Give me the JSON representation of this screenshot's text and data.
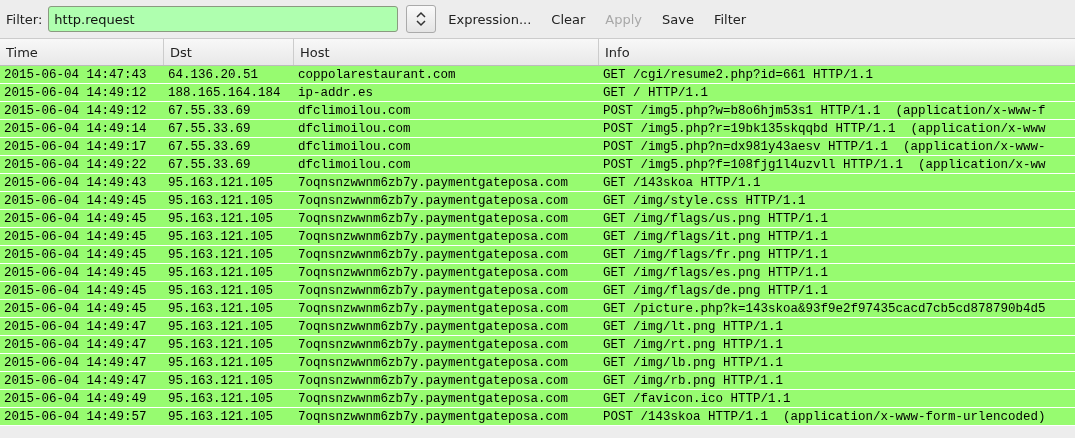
{
  "filter_bar": {
    "label": "Filter:",
    "value": "http.request",
    "valid": true,
    "buttons": [
      {
        "label": "Expression...",
        "disabled": false
      },
      {
        "label": "Clear",
        "disabled": false
      },
      {
        "label": "Apply",
        "disabled": true
      },
      {
        "label": "Save",
        "disabled": false
      },
      {
        "label": "Filter",
        "disabled": false
      }
    ]
  },
  "table": {
    "columns": [
      "Time",
      "Dst",
      "Host",
      "Info"
    ],
    "rows": [
      [
        "2015-06-04 14:47:43",
        "64.136.20.51",
        "coppolarestaurant.com",
        "GET /cgi/resume2.php?id=661 HTTP/1.1"
      ],
      [
        "2015-06-04 14:49:12",
        "188.165.164.184",
        "ip-addr.es",
        "GET / HTTP/1.1"
      ],
      [
        "2015-06-04 14:49:12",
        "67.55.33.69",
        "dfclimoilou.com",
        "POST /img5.php?w=b8o6hjm53s1 HTTP/1.1  (application/x-www-f"
      ],
      [
        "2015-06-04 14:49:14",
        "67.55.33.69",
        "dfclimoilou.com",
        "POST /img5.php?r=19bk135skqqbd HTTP/1.1  (application/x-www"
      ],
      [
        "2015-06-04 14:49:17",
        "67.55.33.69",
        "dfclimoilou.com",
        "POST /img5.php?n=dx981y43aesv HTTP/1.1  (application/x-www-"
      ],
      [
        "2015-06-04 14:49:22",
        "67.55.33.69",
        "dfclimoilou.com",
        "POST /img5.php?f=108fjg1l4uzvll HTTP/1.1  (application/x-ww"
      ],
      [
        "2015-06-04 14:49:43",
        "95.163.121.105",
        "7oqnsnzwwnm6zb7y.paymentgateposa.com",
        "GET /143skoa HTTP/1.1"
      ],
      [
        "2015-06-04 14:49:45",
        "95.163.121.105",
        "7oqnsnzwwnm6zb7y.paymentgateposa.com",
        "GET /img/style.css HTTP/1.1"
      ],
      [
        "2015-06-04 14:49:45",
        "95.163.121.105",
        "7oqnsnzwwnm6zb7y.paymentgateposa.com",
        "GET /img/flags/us.png HTTP/1.1"
      ],
      [
        "2015-06-04 14:49:45",
        "95.163.121.105",
        "7oqnsnzwwnm6zb7y.paymentgateposa.com",
        "GET /img/flags/it.png HTTP/1.1"
      ],
      [
        "2015-06-04 14:49:45",
        "95.163.121.105",
        "7oqnsnzwwnm6zb7y.paymentgateposa.com",
        "GET /img/flags/fr.png HTTP/1.1"
      ],
      [
        "2015-06-04 14:49:45",
        "95.163.121.105",
        "7oqnsnzwwnm6zb7y.paymentgateposa.com",
        "GET /img/flags/es.png HTTP/1.1"
      ],
      [
        "2015-06-04 14:49:45",
        "95.163.121.105",
        "7oqnsnzwwnm6zb7y.paymentgateposa.com",
        "GET /img/flags/de.png HTTP/1.1"
      ],
      [
        "2015-06-04 14:49:45",
        "95.163.121.105",
        "7oqnsnzwwnm6zb7y.paymentgateposa.com",
        "GET /picture.php?k=143skoa&93f9e2f97435cacd7cb5cd878790b4d5"
      ],
      [
        "2015-06-04 14:49:47",
        "95.163.121.105",
        "7oqnsnzwwnm6zb7y.paymentgateposa.com",
        "GET /img/lt.png HTTP/1.1"
      ],
      [
        "2015-06-04 14:49:47",
        "95.163.121.105",
        "7oqnsnzwwnm6zb7y.paymentgateposa.com",
        "GET /img/rt.png HTTP/1.1"
      ],
      [
        "2015-06-04 14:49:47",
        "95.163.121.105",
        "7oqnsnzwwnm6zb7y.paymentgateposa.com",
        "GET /img/lb.png HTTP/1.1"
      ],
      [
        "2015-06-04 14:49:47",
        "95.163.121.105",
        "7oqnsnzwwnm6zb7y.paymentgateposa.com",
        "GET /img/rb.png HTTP/1.1"
      ],
      [
        "2015-06-04 14:49:49",
        "95.163.121.105",
        "7oqnsnzwwnm6zb7y.paymentgateposa.com",
        "GET /favicon.ico HTTP/1.1"
      ],
      [
        "2015-06-04 14:49:57",
        "95.163.121.105",
        "7oqnsnzwwnm6zb7y.paymentgateposa.com",
        "POST /143skoa HTTP/1.1  (application/x-www-form-urlencoded)"
      ]
    ]
  }
}
